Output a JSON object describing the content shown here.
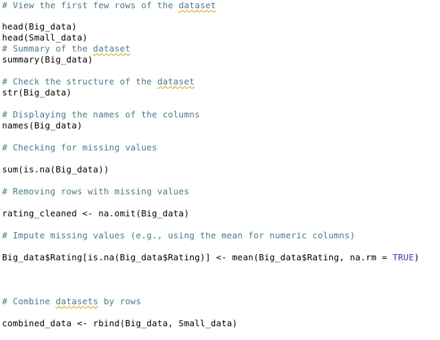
{
  "editor": {
    "lines": [
      {
        "type": "comment",
        "text": "# View the first few rows of the ",
        "underlined": "dataset",
        "tail": ""
      },
      {
        "type": "code",
        "text": "head(Big_data)"
      },
      {
        "type": "code",
        "text": "head(Small_data)"
      },
      {
        "type": "comment",
        "text": "# Summary of the ",
        "underlined": "dataset",
        "tail": ""
      },
      {
        "type": "code",
        "text": "summary(Big_data)"
      },
      {
        "type": "comment",
        "text": "# Check the structure of the ",
        "underlined": "dataset",
        "tail": ""
      },
      {
        "type": "code",
        "text": "str(Big_data)"
      },
      {
        "type": "comment",
        "text": "# Displaying the names of the columns"
      },
      {
        "type": "code",
        "text": "names(Big_data)"
      },
      {
        "type": "comment",
        "text": "# Checking for missing values"
      },
      {
        "type": "code",
        "text": "sum(is.na(Big_data))"
      },
      {
        "type": "comment",
        "text": "# Removing rows with missing values"
      },
      {
        "type": "code",
        "text": "rating_cleaned <- na.omit(Big_data)"
      },
      {
        "type": "comment",
        "text": "# Impute missing values (e.g., using the mean for numeric columns)"
      },
      {
        "type": "code",
        "text": "Big_data$Rating[is.na(Big_data$Rating)] <- mean(Big_data$Rating, na.rm = ",
        "keyword": "TRUE",
        "tail": ")"
      },
      {
        "type": "comment",
        "text": "# Combine ",
        "underlined": "datasets",
        "tail": " by rows"
      },
      {
        "type": "code",
        "text": "combined_data <- rbind(Big_data, Small_data)"
      }
    ]
  },
  "colors": {
    "comment": "#4a7a8a",
    "code": "#000000",
    "keyword": "#3b3bb0",
    "spellcheck": "#c9a000"
  }
}
